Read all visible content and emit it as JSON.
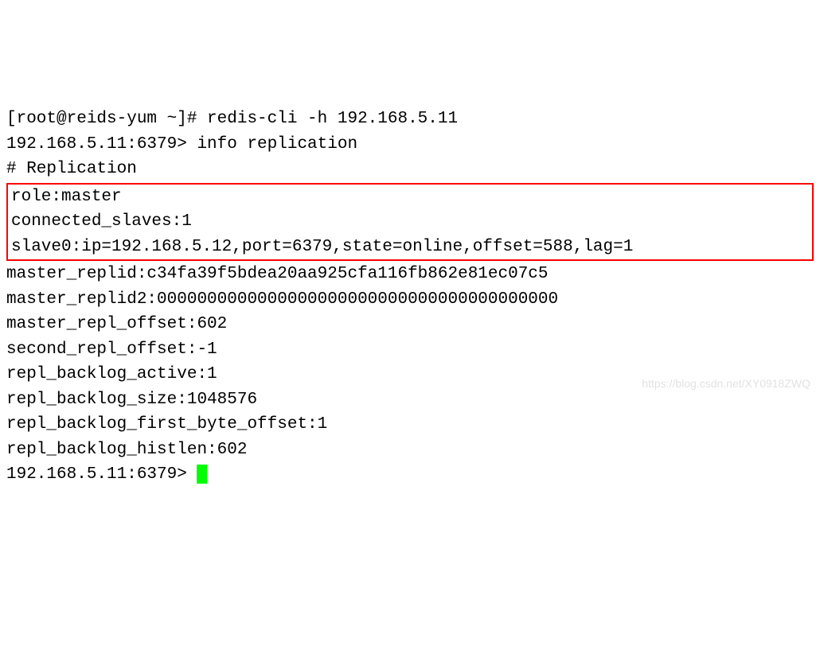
{
  "line1": "[root@reids-yum ~]# redis-cli -h 192.168.5.11",
  "line2": "192.168.5.11:6379> info replication",
  "line3": "# Replication",
  "box1": "role:master",
  "box2": "connected_slaves:1",
  "box3": "slave0:ip=192.168.5.12,port=6379,state=online,offset=588,lag=1",
  "line4": "master_replid:c34fa39f5bdea20aa925cfa116fb862e81ec07c5",
  "line5": "master_replid2:0000000000000000000000000000000000000000",
  "line6": "master_repl_offset:602",
  "line7": "second_repl_offset:-1",
  "line8": "repl_backlog_active:1",
  "line9": "repl_backlog_size:1048576",
  "line10": "repl_backlog_first_byte_offset:1",
  "line11": "repl_backlog_histlen:602",
  "prompt_end": "192.168.5.11:6379> ",
  "watermark": "https://blog.csdn.net/XY0918ZWQ"
}
